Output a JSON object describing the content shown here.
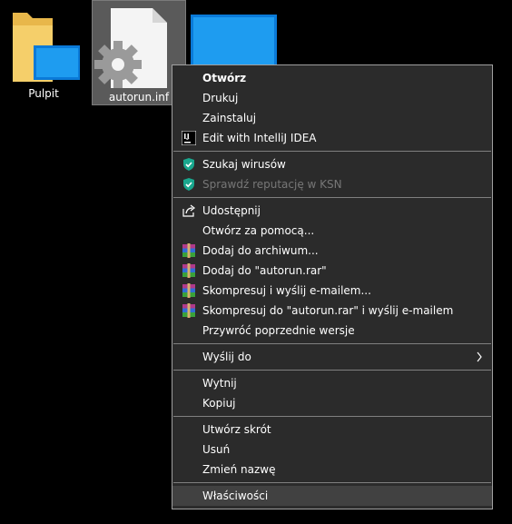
{
  "desktop": {
    "icons": [
      {
        "label": "Pulpit"
      },
      {
        "label": "autorun.inf"
      }
    ]
  },
  "menu": {
    "items": [
      {
        "label": "Otwórz"
      },
      {
        "label": "Drukuj"
      },
      {
        "label": "Zainstaluj"
      },
      {
        "label": "Edit with IntelliJ IDEA"
      },
      {
        "label": "Szukaj wirusów"
      },
      {
        "label": "Sprawdź reputację w KSN"
      },
      {
        "label": "Udostępnij"
      },
      {
        "label": "Otwórz za pomocą..."
      },
      {
        "label": "Dodaj do archiwum..."
      },
      {
        "label": "Dodaj do \"autorun.rar\""
      },
      {
        "label": "Skompresuj i wyślij e-mailem..."
      },
      {
        "label": "Skompresuj do \"autorun.rar\" i wyślij e-mailem"
      },
      {
        "label": "Przywróć poprzednie wersje"
      },
      {
        "label": "Wyślij do"
      },
      {
        "label": "Wytnij"
      },
      {
        "label": "Kopiuj"
      },
      {
        "label": "Utwórz skrót"
      },
      {
        "label": "Usuń"
      },
      {
        "label": "Zmień nazwę"
      },
      {
        "label": "Właściwości"
      }
    ]
  },
  "icons": {
    "intellij": "intellij-icon",
    "kaspersky": "kaspersky-shield-icon",
    "share": "share-icon",
    "winrar": "winrar-icon",
    "submenu": "chevron-right-icon"
  },
  "colors": {
    "menu_bg": "#2b2b2b",
    "highlight": "#414141",
    "disabled_text": "#777777",
    "kaspersky_green": "#19a78e"
  }
}
